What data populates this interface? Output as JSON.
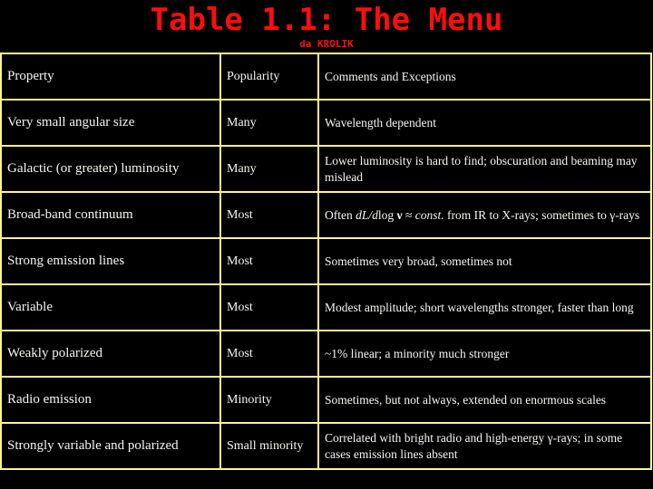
{
  "header": {
    "title": "Table 1.1: The Menu",
    "subtitle": "da KROLIK"
  },
  "colors": {
    "title": "#ff0d0d",
    "border": "#fbf593",
    "text": "#f5f5f0",
    "background": "#000000"
  },
  "table": {
    "columns": [
      "Property",
      "Popularity",
      "Comments and Exceptions"
    ],
    "rows": [
      {
        "property": "Very small angular size",
        "popularity": "Many",
        "comments": "Wavelength dependent"
      },
      {
        "property": "Galactic (or greater) luminosity",
        "popularity": "Many",
        "comments": "Lower luminosity is hard to find; obscuration and beaming may mislead"
      },
      {
        "property": "Broad-band continuum",
        "popularity": "Most",
        "comments_parts": {
          "prefix": "Often ",
          "math_italic": "dL/d",
          "math_log": "log ",
          "math_nu": "ν",
          "approx": " ≈ ",
          "const": "const.",
          "suffix": " from IR to X-rays; sometimes to γ-rays"
        }
      },
      {
        "property": "Strong emission lines",
        "popularity": "Most",
        "comments": "Sometimes very broad, sometimes not"
      },
      {
        "property": "Variable",
        "popularity": "Most",
        "comments": "Modest amplitude; short wavelengths stronger, faster than long"
      },
      {
        "property": "Weakly polarized",
        "popularity": "Most",
        "comments": "~1% linear; a minority much stronger"
      },
      {
        "property": "Radio emission",
        "popularity": "Minority",
        "comments": "Sometimes, but not always, extended on enormous scales"
      },
      {
        "property": "Strongly variable and polarized",
        "popularity": "Small minority",
        "comments": "Correlated with bright radio and high-energy γ-rays; in some cases emission lines absent"
      }
    ]
  }
}
